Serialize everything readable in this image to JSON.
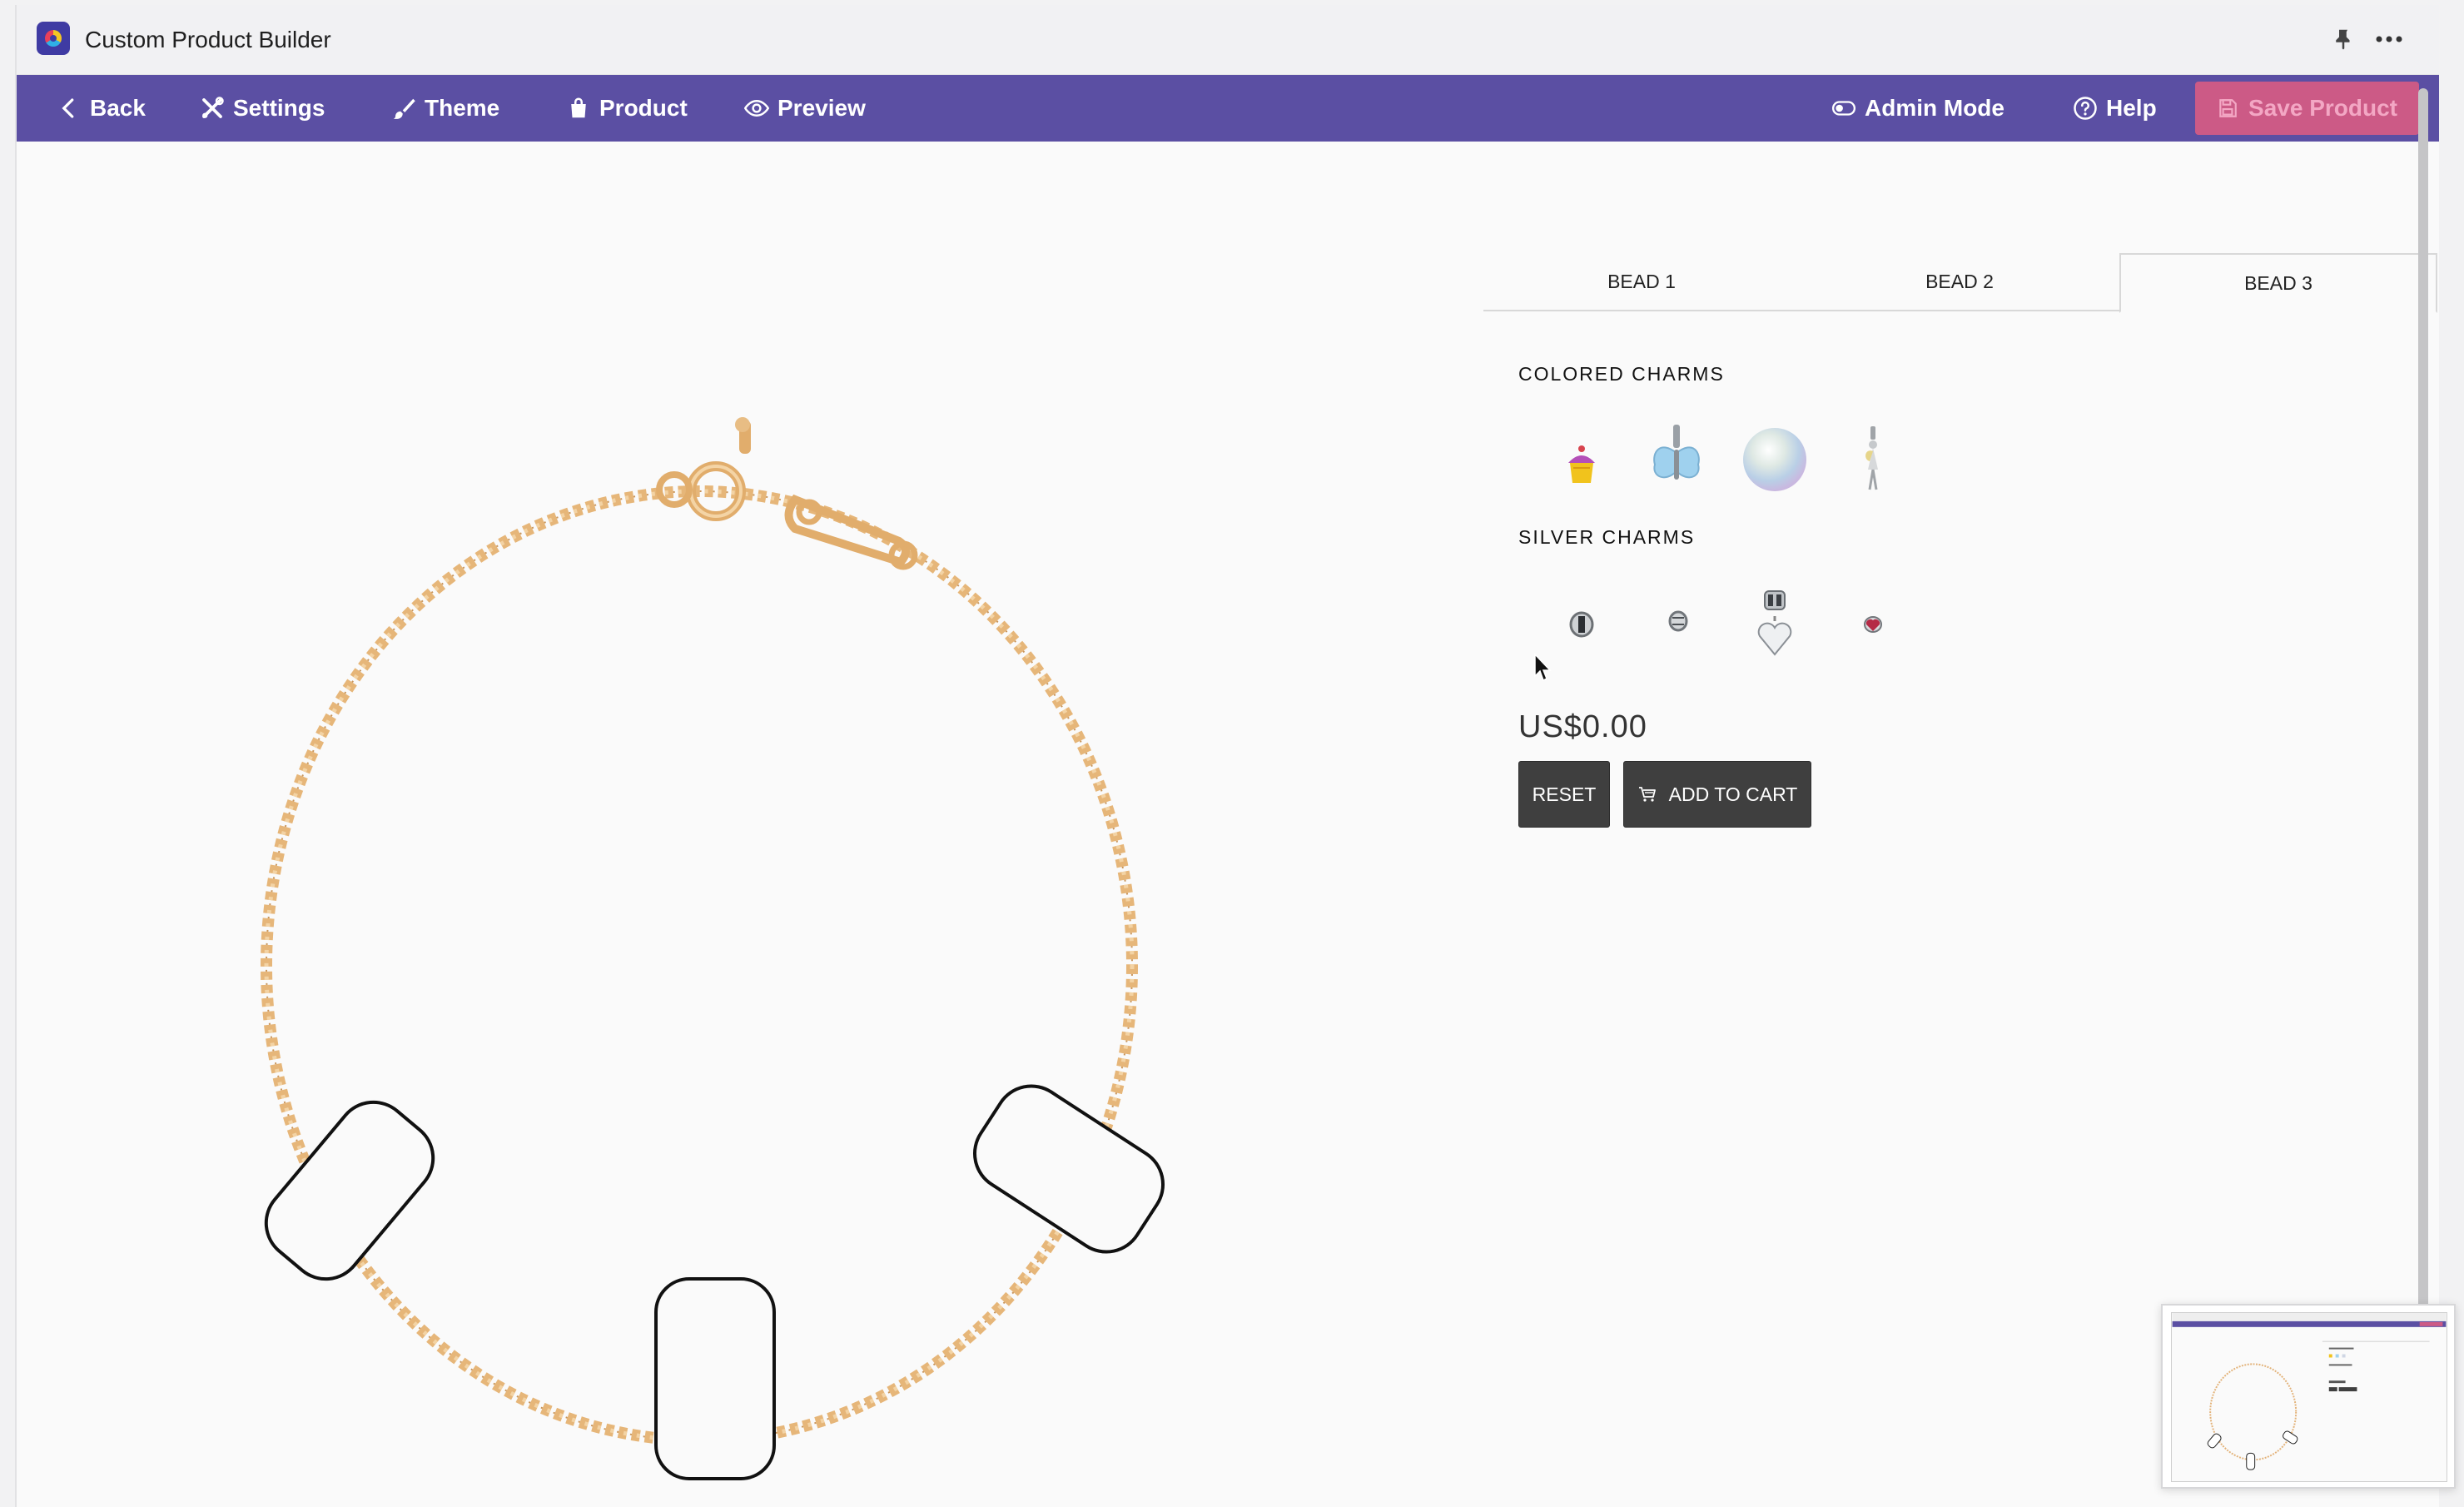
{
  "window": {
    "title": "Custom Product Builder"
  },
  "toolbar": {
    "back_label": "Back",
    "settings_label": "Settings",
    "theme_label": "Theme",
    "product_label": "Product",
    "preview_label": "Preview",
    "admin_mode_label": "Admin Mode",
    "help_label": "Help",
    "save_label": "Save Product",
    "colors": {
      "background": "#5b4fa3",
      "save_button": "#cc5a86"
    }
  },
  "tabs": [
    {
      "label": "BEAD 1",
      "active": false
    },
    {
      "label": "BEAD 2",
      "active": false
    },
    {
      "label": "BEAD 3",
      "active": true
    }
  ],
  "charm_sections": [
    {
      "heading": "COLORED CHARMS",
      "charms": [
        "cupcake-charm-icon",
        "butterfly-charm-icon",
        "pearl-charm-icon",
        "fairy-charm-icon"
      ]
    },
    {
      "heading": "SILVER CHARMS",
      "charms": [
        "round-bead-charm-icon",
        "small-bead-charm-icon",
        "heart-dangle-charm-icon",
        "red-heart-charm-icon"
      ]
    }
  ],
  "price": "US$0.00",
  "actions": {
    "reset_label": "RESET",
    "add_to_cart_label": "ADD TO CART"
  },
  "bracelet": {
    "chain_color": "#e3b37a",
    "bead_slots": 3
  }
}
